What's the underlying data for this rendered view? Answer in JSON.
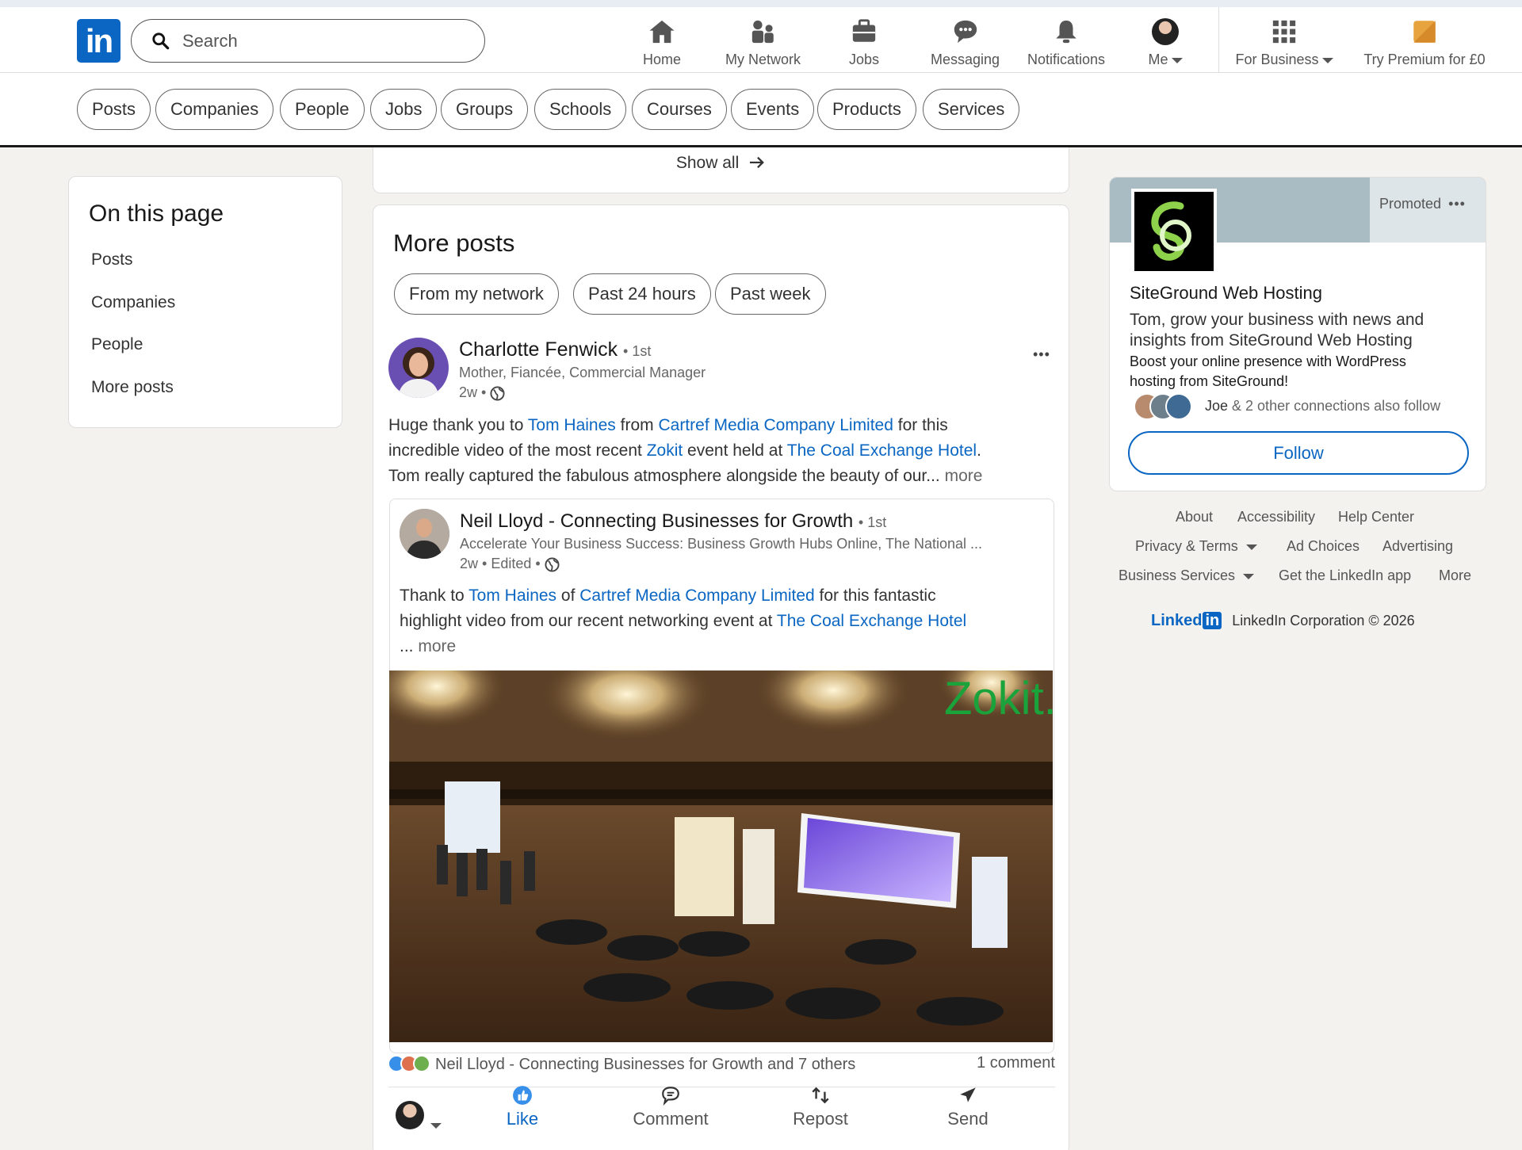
{
  "nav": {
    "logo": "in",
    "search_placeholder": "Search",
    "items": [
      {
        "label": "Home",
        "icon": "home-icon"
      },
      {
        "label": "My Network",
        "icon": "network-icon"
      },
      {
        "label": "Jobs",
        "icon": "briefcase-icon"
      },
      {
        "label": "Messaging",
        "icon": "messaging-icon"
      },
      {
        "label": "Notifications",
        "icon": "bell-icon"
      },
      {
        "label": "Me",
        "icon": "avatar"
      },
      {
        "label": "For Business",
        "icon": "grid-icon"
      },
      {
        "label": "Try Premium for £0",
        "icon": "premium-icon"
      }
    ]
  },
  "filters": [
    "Posts",
    "Companies",
    "People",
    "Jobs",
    "Groups",
    "Schools",
    "Courses",
    "Events",
    "Products",
    "Services"
  ],
  "on_this_page": {
    "title": "On this page",
    "links": [
      "Posts",
      "Companies",
      "People",
      "More posts"
    ]
  },
  "show_all": "Show all",
  "more_posts": {
    "title": "More posts",
    "chips": [
      "From my network",
      "Past 24 hours",
      "Past week"
    ],
    "post": {
      "author": "Charlotte Fenwick",
      "degree": "• 1st",
      "headline": "Mother, Fiancée, Commercial Manager",
      "time": "2w •",
      "body": {
        "t1": "Huge thank you to ",
        "l1": "Tom Haines",
        "t2": " from ",
        "l2": "Cartref Media Company Limited",
        "t3": " for this",
        "t4": "incredible video of the most recent ",
        "l3": "Zokit",
        "t5": " event held at ",
        "l4": "The Coal Exchange Hotel",
        "t6": ".",
        "t7": "Tom really captured the fabulous atmosphere alongside the beauty of our...",
        "more": " more"
      },
      "reshare": {
        "author": "Neil Lloyd - Connecting Businesses for Growth",
        "degree": "• 1st",
        "headline": "Accelerate Your Business Success: Business Growth Hubs Online, The National ...",
        "time": "2w • Edited •",
        "body": {
          "t1": "Thank to ",
          "l1": "Tom Haines",
          "t2": " of ",
          "l2": "Cartref Media Company Limited",
          "t3": " for this fantastic",
          "t4": "highlight video from our recent networking event at ",
          "l3": "The Coal Exchange Hotel",
          "t5": "... ",
          "more": "more"
        },
        "video_overlay": "Zokit."
      },
      "reactions_text": "Neil Lloyd - Connecting Businesses for Growth and 7 others",
      "comments": "1 comment",
      "actions": {
        "like": "Like",
        "comment": "Comment",
        "repost": "Repost",
        "send": "Send"
      },
      "menu": "•••"
    }
  },
  "ad": {
    "promoted": "Promoted",
    "menu": "•••",
    "name": "SiteGround Web Hosting",
    "line1": "Tom, grow your business with news and",
    "line2": "insights from SiteGround Web Hosting",
    "line3": "Boost your online presence with WordPress",
    "line4": "hosting from SiteGround!",
    "connections": "Joe",
    "connections_rest": " & 2 other connections also follow",
    "follow": "Follow"
  },
  "footer": {
    "about": "About",
    "accessibility": "Accessibility",
    "help": "Help Center",
    "privacy": "Privacy & Terms",
    "adchoices": "Ad Choices",
    "advertising": "Advertising",
    "business": "Business Services",
    "getapp": "Get the LinkedIn app",
    "more": "More",
    "brand": "Linked",
    "brand_in": "in",
    "copyright": "LinkedIn Corporation © 2026"
  },
  "colors": {
    "brand": "#0a66c2",
    "background": "#f4f2ee",
    "premium": "#e7a33e"
  }
}
